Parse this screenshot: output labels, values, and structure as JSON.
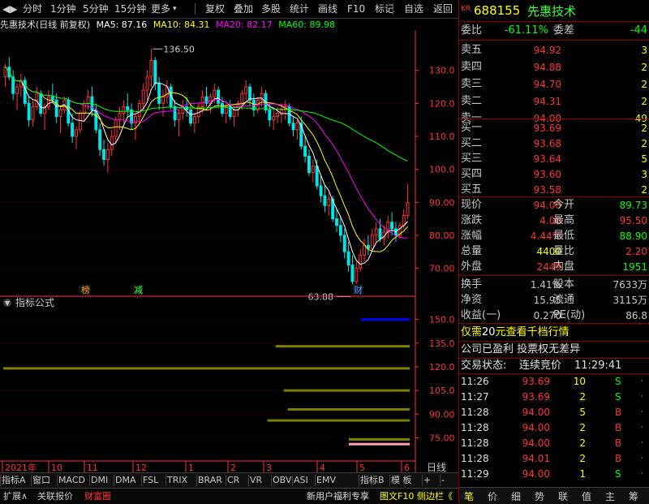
{
  "toolbar": {
    "items": [
      "分时",
      "1分钟",
      "5分钟",
      "15分钟",
      "更多",
      "复权",
      "叠加",
      "多股",
      "统计",
      "画线",
      "F10",
      "标记",
      "自选",
      "返回"
    ]
  },
  "info": {
    "title": "先惠技术(日线 前复权)",
    "ma5": "MA5: 87.16",
    "ma10": "MA10: 84.31",
    "ma20": "MA20: 82.17",
    "ma60": "MA60: 89.98"
  },
  "colors": {
    "up": "#ff3232",
    "down": "#00e5e5",
    "ma5": "#ffffff",
    "ma10": "#ffff00",
    "ma20": "#ff00ff",
    "ma60": "#00ff00",
    "axis": "#ff3232",
    "panel_border": "#8b0000"
  },
  "chart_data": [
    {
      "type": "candlestick",
      "title": "先惠技术(日线 前复权)",
      "y_ticks": [
        "130.0",
        "120.0",
        "110.0",
        "100.0",
        "90.00",
        "80.00",
        "70.00"
      ],
      "ylim": [
        64,
        141
      ],
      "x_ticks": [
        "2021年",
        "10",
        "11",
        "12",
        "1",
        "2",
        "3",
        "4",
        "5",
        "6"
      ],
      "annotations": {
        "high": "136.50",
        "low": "63.88",
        "tag1": "榜",
        "tag2": "减",
        "tag3": "财"
      },
      "series": [
        {
          "name": "MA5",
          "value": 87.16
        },
        {
          "name": "MA10",
          "value": 84.31
        },
        {
          "name": "MA20",
          "value": 82.17
        },
        {
          "name": "MA60",
          "value": 89.98
        }
      ],
      "ohlc": [
        [
          128,
          132,
          125,
          131
        ],
        [
          131,
          134,
          127,
          128
        ],
        [
          128,
          130,
          121,
          123
        ],
        [
          123,
          126,
          118,
          125
        ],
        [
          125,
          129,
          122,
          127
        ],
        [
          127,
          128,
          119,
          120
        ],
        [
          120,
          122,
          113,
          115
        ],
        [
          115,
          121,
          113,
          119
        ],
        [
          119,
          125,
          118,
          123
        ],
        [
          123,
          124,
          116,
          117
        ],
        [
          117,
          120,
          112,
          119
        ],
        [
          119,
          124,
          118,
          122
        ],
        [
          122,
          126,
          120,
          121
        ],
        [
          121,
          123,
          114,
          116
        ],
        [
          116,
          119,
          111,
          118
        ],
        [
          118,
          122,
          117,
          121
        ],
        [
          121,
          122,
          113,
          114
        ],
        [
          114,
          117,
          108,
          110
        ],
        [
          110,
          113,
          106,
          112
        ],
        [
          112,
          118,
          111,
          117
        ],
        [
          117,
          121,
          115,
          120
        ],
        [
          120,
          124,
          118,
          122
        ],
        [
          122,
          125,
          116,
          118
        ],
        [
          118,
          120,
          111,
          112
        ],
        [
          112,
          114,
          104,
          106
        ],
        [
          106,
          109,
          101,
          103
        ],
        [
          103,
          108,
          99,
          106
        ],
        [
          106,
          112,
          104,
          110
        ],
        [
          110,
          116,
          108,
          115
        ],
        [
          115,
          119,
          112,
          117
        ],
        [
          117,
          121,
          114,
          119
        ],
        [
          119,
          123,
          116,
          118
        ],
        [
          118,
          120,
          112,
          114
        ],
        [
          114,
          117,
          109,
          116
        ],
        [
          116,
          121,
          114,
          120
        ],
        [
          120,
          126,
          118,
          124
        ],
        [
          124,
          130,
          121,
          128
        ],
        [
          128,
          136.5,
          125,
          133
        ],
        [
          133,
          134,
          124,
          126
        ],
        [
          126,
          128,
          118,
          120
        ],
        [
          120,
          124,
          116,
          122
        ],
        [
          122,
          127,
          120,
          125
        ],
        [
          125,
          126,
          118,
          119
        ],
        [
          119,
          121,
          113,
          115
        ],
        [
          115,
          118,
          110,
          117
        ],
        [
          117,
          121,
          115,
          119
        ],
        [
          119,
          122,
          116,
          118
        ],
        [
          118,
          120,
          113,
          114
        ],
        [
          114,
          117,
          111,
          116
        ],
        [
          116,
          120,
          114,
          119
        ],
        [
          119,
          124,
          117,
          122
        ],
        [
          122,
          125,
          119,
          120
        ],
        [
          120,
          123,
          117,
          122
        ],
        [
          122,
          126,
          120,
          124
        ],
        [
          124,
          125,
          119,
          120
        ],
        [
          120,
          122,
          116,
          117
        ],
        [
          117,
          120,
          114,
          119
        ],
        [
          119,
          121,
          115,
          116
        ],
        [
          116,
          119,
          113,
          118
        ],
        [
          118,
          121,
          116,
          120
        ],
        [
          120,
          124,
          118,
          123
        ],
        [
          123,
          127,
          121,
          125
        ],
        [
          125,
          126,
          119,
          121
        ],
        [
          121,
          123,
          116,
          118
        ],
        [
          118,
          122,
          117,
          121
        ],
        [
          121,
          125,
          119,
          123
        ],
        [
          123,
          124,
          117,
          118
        ],
        [
          118,
          120,
          113,
          115
        ],
        [
          115,
          118,
          112,
          116
        ],
        [
          116,
          119,
          114,
          117
        ],
        [
          117,
          120,
          114,
          118
        ],
        [
          118,
          121,
          115,
          119
        ],
        [
          119,
          120,
          113,
          114
        ],
        [
          114,
          116,
          110,
          112
        ],
        [
          112,
          115,
          109,
          114
        ],
        [
          114,
          116,
          106,
          107
        ],
        [
          107,
          110,
          102,
          104
        ],
        [
          104,
          106,
          98,
          99
        ],
        [
          99,
          103,
          96,
          101
        ],
        [
          101,
          103,
          94,
          95
        ],
        [
          95,
          98,
          90,
          92
        ],
        [
          92,
          95,
          87,
          89
        ],
        [
          89,
          93,
          86,
          91
        ],
        [
          91,
          92,
          84,
          85
        ],
        [
          85,
          88,
          81,
          83
        ],
        [
          83,
          86,
          78,
          80
        ],
        [
          80,
          82,
          73,
          75
        ],
        [
          75,
          78,
          69,
          71
        ],
        [
          71,
          74,
          63.88,
          66
        ],
        [
          66,
          72,
          65,
          70
        ],
        [
          70,
          76,
          69,
          74
        ],
        [
          74,
          79,
          72,
          77
        ],
        [
          77,
          80,
          74,
          76
        ],
        [
          76,
          82,
          75,
          80
        ],
        [
          80,
          84,
          78,
          82
        ],
        [
          82,
          85,
          78,
          79
        ],
        [
          79,
          83,
          77,
          81
        ],
        [
          81,
          86,
          79,
          84
        ],
        [
          84,
          87,
          80,
          82
        ],
        [
          82,
          84,
          78,
          80
        ],
        [
          80,
          84,
          79,
          83
        ],
        [
          83,
          88,
          82,
          86
        ],
        [
          86,
          95.5,
          85,
          90
        ]
      ]
    },
    {
      "type": "bar",
      "title": "指标公式",
      "y_ticks": [
        "150.0",
        "135.0",
        "120.0",
        "105.0",
        "90.00",
        "75.00"
      ],
      "ylim": [
        67,
        157
      ],
      "bars": [
        {
          "value": 150,
          "start": 0.88,
          "color": "#0000ff"
        },
        {
          "value": 133,
          "start": 0.67,
          "color": "#808000"
        },
        {
          "value": 119,
          "start": 0.0,
          "color": "#808000"
        },
        {
          "value": 105,
          "start": 0.69,
          "color": "#808000"
        },
        {
          "value": 93,
          "start": 0.7,
          "color": "#808000"
        },
        {
          "value": 86,
          "start": 0.65,
          "color": "#808000"
        },
        {
          "value": 74,
          "start": 0.85,
          "color": "#808000"
        },
        {
          "value": 71,
          "start": 0.85,
          "color": "#ffa0a0"
        }
      ]
    }
  ],
  "quote": {
    "code": "688155",
    "name": "先惠技术",
    "tag": "KR",
    "wei_bi_label": "委比",
    "wei_bi_value": "-61.11%",
    "wei_cha_label": "委差",
    "wei_cha_value": "-44",
    "asks": [
      {
        "label": "卖五",
        "price": "94.92",
        "vol": "3"
      },
      {
        "label": "卖四",
        "price": "94.88",
        "vol": "2"
      },
      {
        "label": "卖三",
        "price": "94.70",
        "vol": "2"
      },
      {
        "label": "卖二",
        "price": "94.31",
        "vol": "2"
      },
      {
        "label": "卖一",
        "price": "94.00",
        "vol": "49"
      }
    ],
    "bids": [
      {
        "label": "买一",
        "price": "93.69",
        "vol": "2"
      },
      {
        "label": "买二",
        "price": "93.68",
        "vol": "2"
      },
      {
        "label": "买三",
        "price": "93.64",
        "vol": "5"
      },
      {
        "label": "买四",
        "price": "93.60",
        "vol": "3"
      },
      {
        "label": "买五",
        "price": "93.58",
        "vol": "2"
      }
    ],
    "stats": [
      {
        "l1": "现价",
        "v1": "94.00",
        "c1": "#ff3232",
        "l2": "今开",
        "v2": "89.73",
        "c2": "#00ff00"
      },
      {
        "l1": "涨跌",
        "v1": "4.00",
        "c1": "#ff3232",
        "l2": "最高",
        "v2": "95.50",
        "c2": "#ff3232"
      },
      {
        "l1": "涨幅",
        "v1": "4.44%",
        "c1": "#ff3232",
        "l2": "最低",
        "v2": "88.90",
        "c2": "#00ff00"
      },
      {
        "l1": "总量",
        "v1": "4400",
        "c1": "#ffff00",
        "l2": "量比",
        "v2": "2.20",
        "c2": "#ff3232"
      },
      {
        "l1": "外盘",
        "v1": "2449",
        "c1": "#ff3232",
        "l2": "内盘",
        "v2": "1951",
        "c2": "#00ff00"
      }
    ],
    "fin": [
      {
        "l1": "换手",
        "v1": "1.41%",
        "l2": "股本",
        "v2": "7633万"
      },
      {
        "l1": "净资",
        "v1": "15.95",
        "l2": "流通",
        "v2": "3115万"
      },
      {
        "l1": "收益(一)",
        "v1": "0.270",
        "l2": "PE(动)",
        "v2": "86.8"
      }
    ],
    "promo_pre": "仅需",
    "promo_num": "20",
    "promo_post": "元查看千档行情",
    "notice": "公司已盈利 投票权无差异",
    "trade_status_label": "交易状态:",
    "trade_status_value": "连续竞价",
    "trade_time": "11:29:41",
    "ticks": [
      {
        "time": "11:26",
        "price": "93.69",
        "vol": "10",
        "side": "S"
      },
      {
        "time": "11:27",
        "price": "93.69",
        "vol": "2",
        "side": "S"
      },
      {
        "time": "11:28",
        "price": "94.00",
        "vol": "5",
        "side": "B"
      },
      {
        "time": "11:28",
        "price": "94.00",
        "vol": "2",
        "side": "B"
      },
      {
        "time": "11:28",
        "price": "94.00",
        "vol": "2",
        "side": "B"
      },
      {
        "time": "11:28",
        "price": "94.01",
        "vol": "2",
        "side": "B"
      },
      {
        "time": "11:29",
        "price": "94.00",
        "vol": "1",
        "side": "S"
      }
    ],
    "period_label": "日线"
  },
  "indicator_tabs": [
    "指标A",
    "窗口",
    "MACD",
    "DMI",
    "DMA",
    "FSL",
    "TRIX",
    "BRAR",
    "CR",
    "VR",
    "OBV",
    "ASI",
    "EMV"
  ],
  "indicator_tabs_right": [
    "指标B",
    "模 板",
    "+",
    "-"
  ],
  "status": {
    "left": [
      "扩展∧",
      "关联报价",
      "财富圈"
    ],
    "right": [
      "新用户福利专享",
      "图文F10",
      "侧边栏《"
    ]
  },
  "nav": [
    "笔",
    "价",
    "细",
    "势",
    "联",
    "值",
    "主",
    "筹"
  ]
}
